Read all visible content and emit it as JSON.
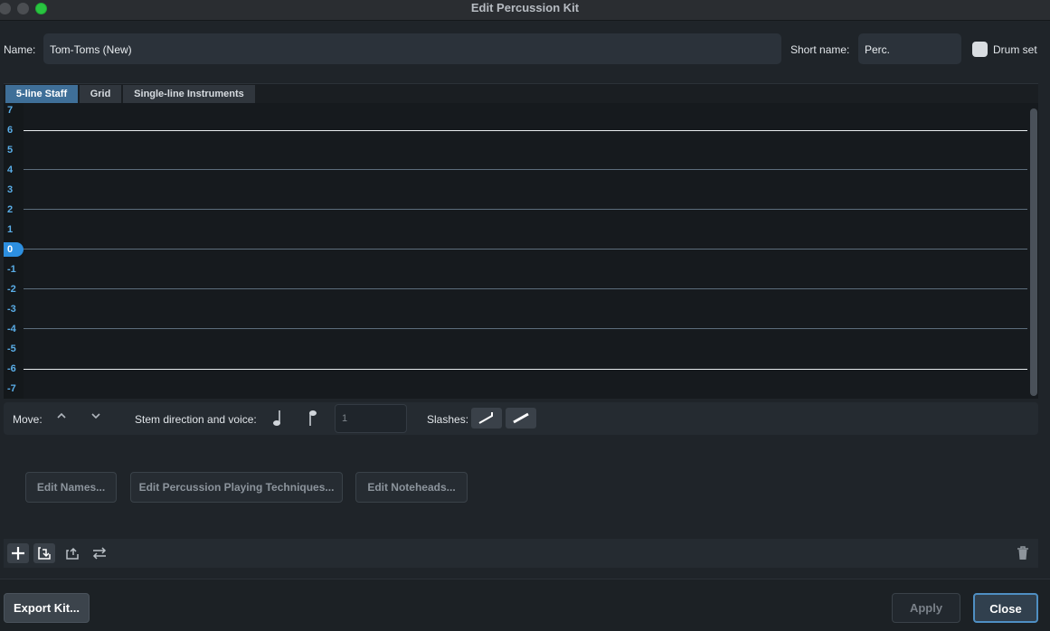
{
  "window": {
    "title": "Edit Percussion Kit"
  },
  "name_row": {
    "name_label": "Name:",
    "name_value": "Tom-Toms (New)",
    "short_label": "Short name:",
    "short_value": "Perc.",
    "drum_set_label": "Drum set"
  },
  "tabs": [
    {
      "label": "5-line Staff"
    },
    {
      "label": "Grid"
    },
    {
      "label": "Single-line Instruments"
    }
  ],
  "staff_positions": [
    "7",
    "6",
    "5",
    "4",
    "3",
    "2",
    "1",
    "0",
    "-1",
    "-2",
    "-3",
    "-4",
    "-5",
    "-6",
    "-7"
  ],
  "selected_position": "0",
  "movebar": {
    "move_label": "Move:",
    "stem_label": "Stem direction and voice:",
    "voice_value": "1",
    "slashes_label": "Slashes:",
    "up_icon": "chevron-up-icon",
    "down_icon": "chevron-down-icon"
  },
  "edit_buttons": {
    "names": "Edit Names...",
    "techniques": "Edit Percussion Playing Techniques...",
    "noteheads": "Edit Noteheads..."
  },
  "toolbar": {
    "icons": [
      "plus-icon",
      "import-icon",
      "export-icon",
      "swap-icon",
      "trash-icon"
    ]
  },
  "footer": {
    "export_label": "Export Kit...",
    "apply_label": "Apply",
    "close_label": "Close"
  },
  "colors": {
    "accent": "#2d8fe0",
    "background": "#1f2429",
    "close_border": "#4f8fc3"
  }
}
